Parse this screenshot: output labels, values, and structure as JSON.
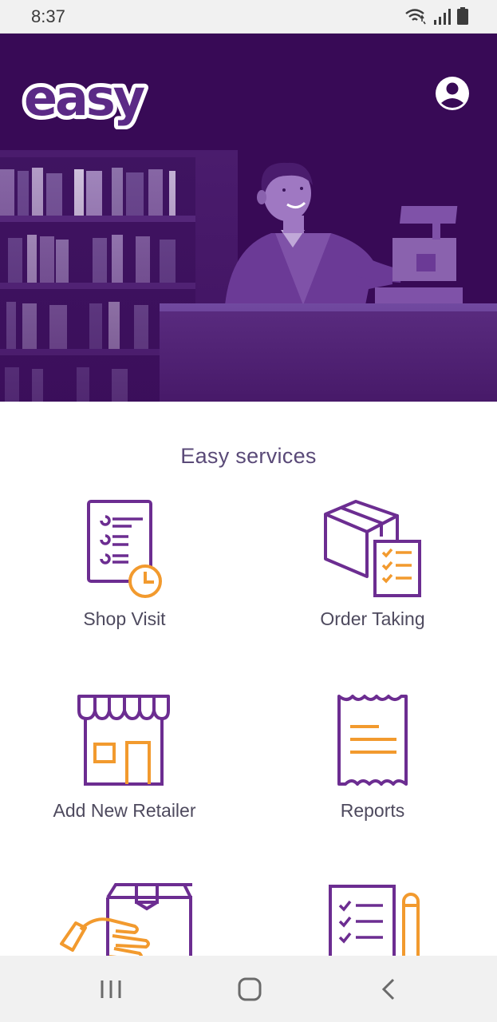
{
  "status_bar": {
    "time": "8:37",
    "icons": [
      "wifi-icon",
      "signal-icon",
      "battery-icon"
    ]
  },
  "header": {
    "logo_text": "easy",
    "profile_icon": "account-circle-icon"
  },
  "colors": {
    "primary": "#380a56",
    "primary_light": "#6b3a96",
    "accent": "#f29a2e",
    "label": "#4e4a5e",
    "section_title": "#5a4a78"
  },
  "main": {
    "section_title": "Easy services",
    "services": [
      {
        "label": "Shop Visit",
        "icon": "checklist-clock-icon"
      },
      {
        "label": "Order Taking",
        "icon": "box-checklist-icon"
      },
      {
        "label": "Add New Retailer",
        "icon": "storefront-icon"
      },
      {
        "label": "Reports",
        "icon": "receipt-icon"
      },
      {
        "label": "",
        "icon": "hand-box-icon"
      },
      {
        "label": "",
        "icon": "checklist-pencil-icon"
      }
    ]
  },
  "nav_bar": {
    "buttons": [
      "recent-apps-icon",
      "home-icon",
      "back-icon"
    ]
  }
}
